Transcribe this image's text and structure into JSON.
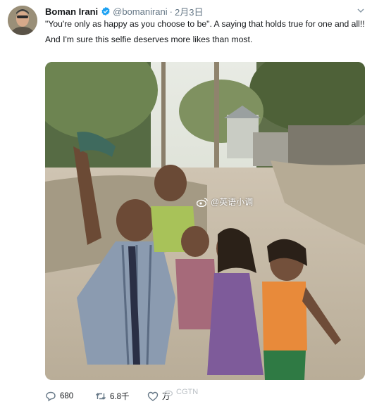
{
  "tweet": {
    "author_name": "Boman Irani",
    "handle": "@bomanirani",
    "separator": "·",
    "date": "2月3日",
    "text_line1": "\"You're only as happy as you choose to be\". A saying that holds true for one and all!!",
    "text_line2": "And I'm sure this selfie deserves more likes than most.",
    "photo_watermark": "@英语小调",
    "actions": {
      "reply_count": "680",
      "retweet_count": "6.8千",
      "like_count": "万"
    },
    "source_watermark": "CGTN"
  },
  "colors": {
    "verified": "#1da1f2",
    "secondary_text": "#657786",
    "primary_text": "#14171a"
  },
  "icons": [
    "verified-badge-icon",
    "caret-down-icon",
    "weibo-icon",
    "reply-icon",
    "retweet-icon",
    "like-icon"
  ]
}
